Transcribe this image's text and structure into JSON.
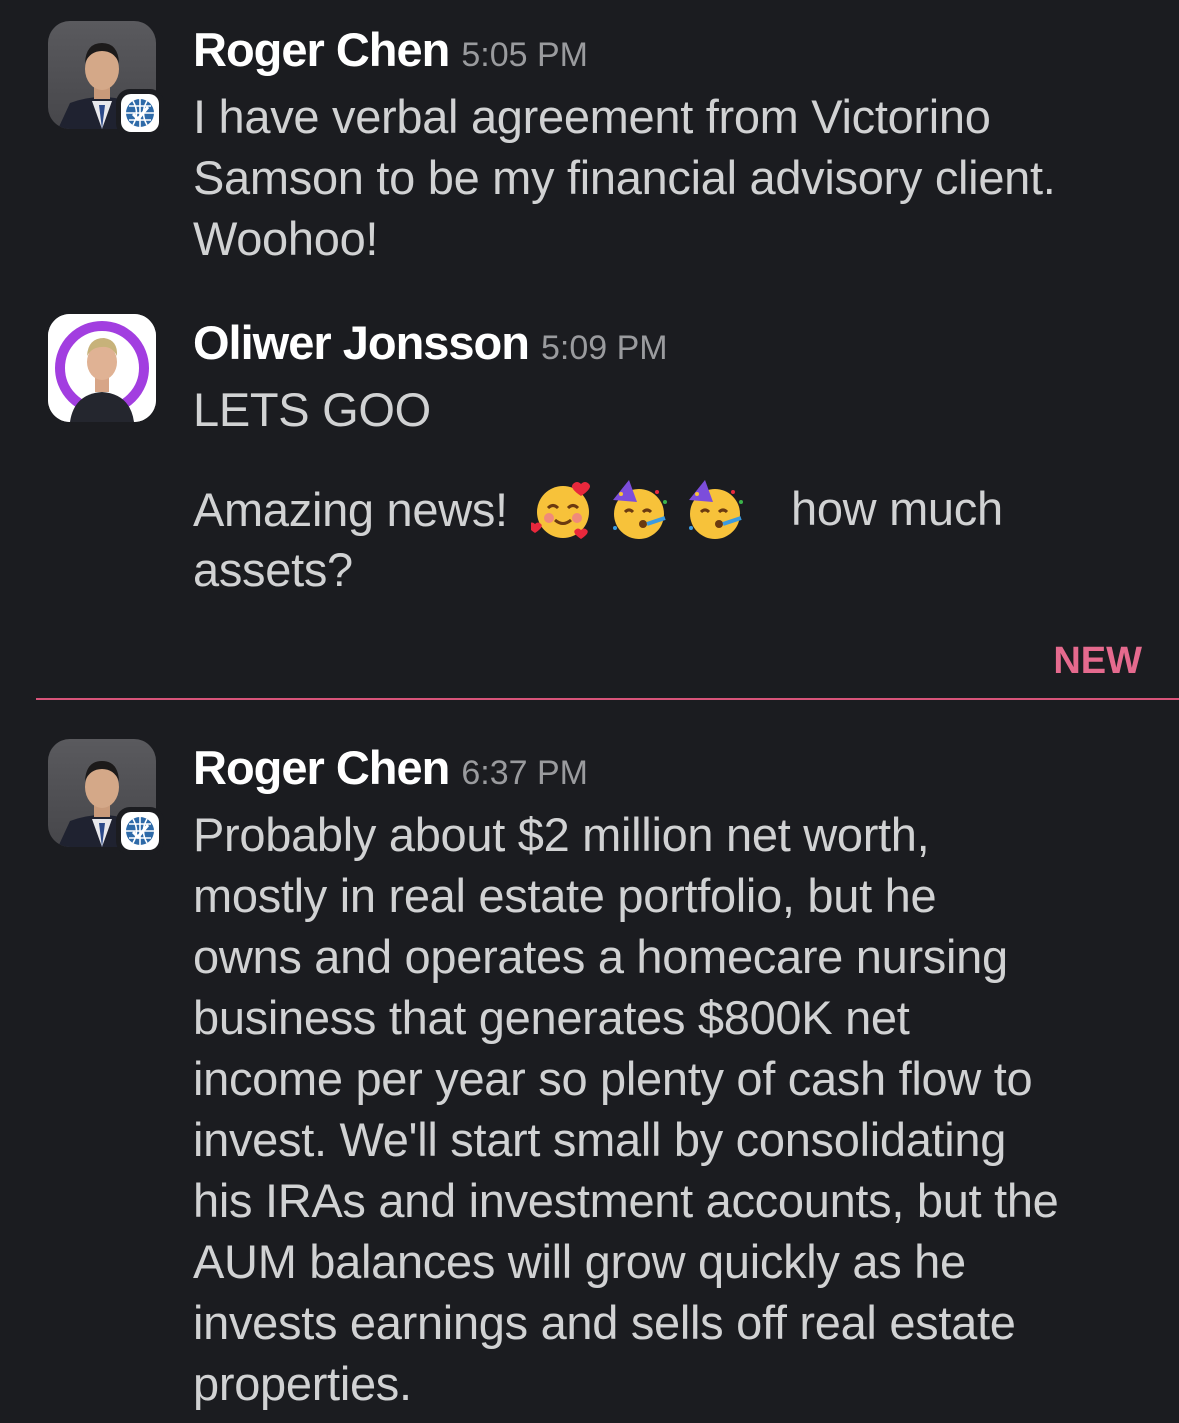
{
  "messages": [
    {
      "author": "Roger Chen",
      "time": "5:05 PM",
      "avatar_icon": "person-photo-roger",
      "badge_icon": "globe-check-badge",
      "text": "I have verbal agreement from Victorino\nSamson to be my financial advisory client.\nWoohoo!"
    },
    {
      "author": "Oliwer Jonsson",
      "time": "5:09 PM",
      "avatar_icon": "person-photo-oliwer",
      "text": "LETS GOO",
      "followup_before": "Amazing news!",
      "followup_emojis": [
        "smiling-face-with-hearts",
        "partying-face",
        "partying-face"
      ],
      "followup_after": "how much\nassets?"
    },
    {
      "author": "Roger Chen",
      "time": "6:37 PM",
      "avatar_icon": "person-photo-roger",
      "badge_icon": "globe-check-badge",
      "text": "Probably about $2 million net worth,\nmostly in real estate portfolio, but he\nowns and operates a homecare nursing\nbusiness that generates $800K net\nincome per year so plenty of cash flow to\ninvest. We'll start small by consolidating\nhis IRAs and investment accounts, but the\nAUM balances will grow quickly as he\ninvests earnings and sells off real estate\nproperties."
    }
  ],
  "divider": {
    "label": "NEW",
    "color": "#d8547a"
  },
  "colors": {
    "background": "#1b1c20",
    "name": "#ffffff",
    "text": "#d1d2d3",
    "timestamp": "#9a9b9e",
    "new_accent": "#e56a8e"
  }
}
